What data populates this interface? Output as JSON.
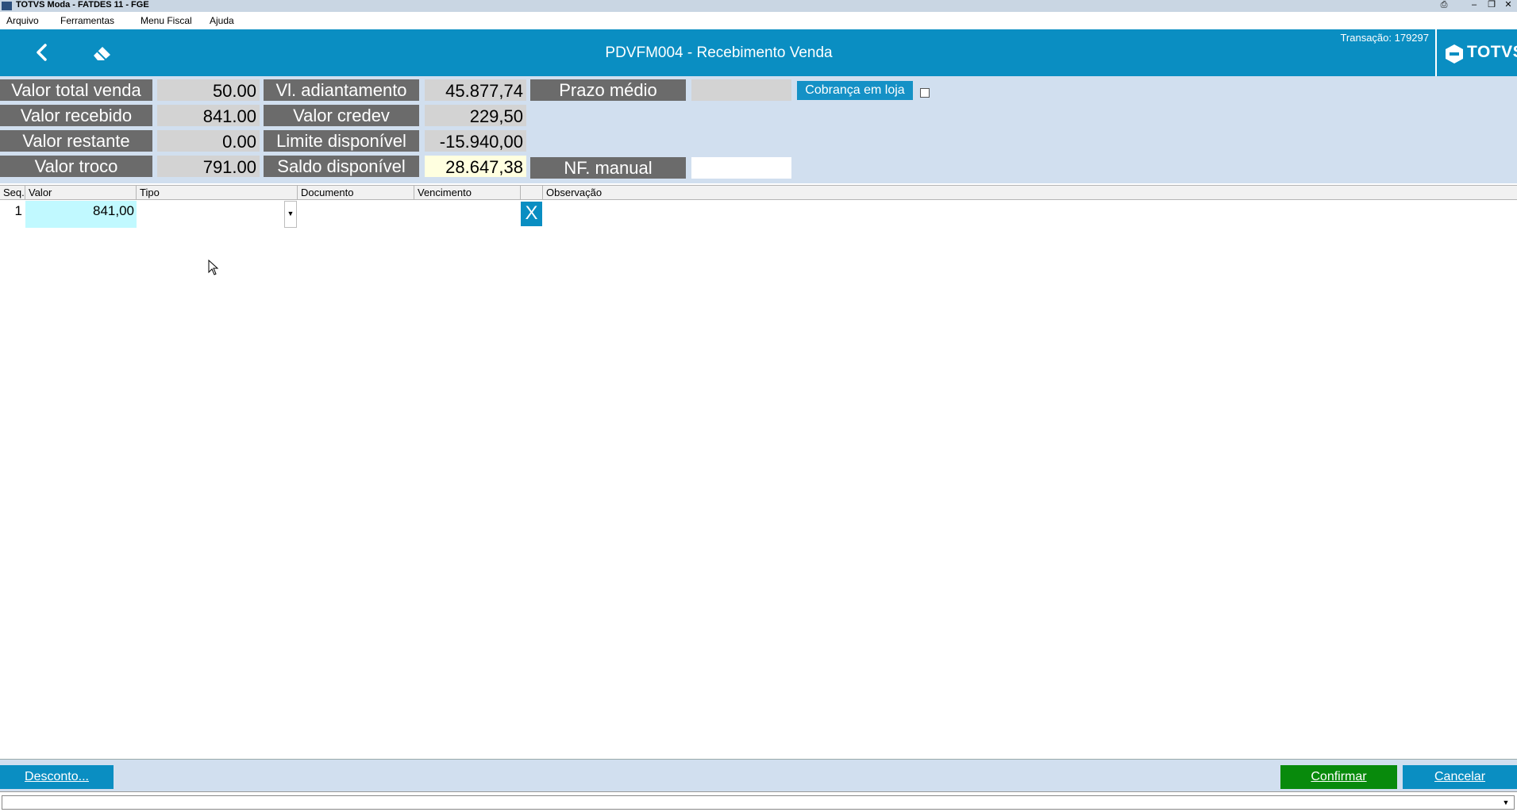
{
  "window": {
    "title": "TOTVS Moda - FATDES 11 - FGE"
  },
  "menu": {
    "items": [
      "Arquivo",
      "Ferramentas",
      "Menu Fiscal",
      "Ajuda"
    ]
  },
  "header": {
    "title": "PDVFM004 - Recebimento Venda",
    "transaction": "Transação: 179297",
    "logo_text": "TOTVS"
  },
  "summary": {
    "valor_total_venda": {
      "label": "Valor total venda",
      "value": "50.00"
    },
    "valor_recebido": {
      "label": "Valor recebido",
      "value": "841.00"
    },
    "valor_restante": {
      "label": "Valor restante",
      "value": "0.00"
    },
    "valor_troco": {
      "label": "Valor troco",
      "value": "791.00"
    },
    "vl_adiantamento": {
      "label": "Vl. adiantamento",
      "value": "45.877,74"
    },
    "valor_credev": {
      "label": "Valor credev",
      "value": "229,50"
    },
    "limite_disponivel": {
      "label": "Limite disponível",
      "value": "-15.940,00"
    },
    "saldo_disponivel": {
      "label": "Saldo disponível",
      "value": "28.647,38"
    },
    "prazo_medio": {
      "label": "Prazo médio",
      "value": ""
    },
    "nf_manual": {
      "label": "NF. manual",
      "value": ""
    },
    "cobranca_button": "Cobrança em loja"
  },
  "grid": {
    "columns": [
      "Seq.",
      "Valor",
      "Tipo",
      "Documento",
      "Vencimento",
      "",
      "Observação"
    ],
    "rows": [
      {
        "seq": "1",
        "valor": "841,00",
        "tipo": "",
        "documento": "",
        "vencimento": "",
        "observacao": ""
      }
    ],
    "delete_label": "X"
  },
  "footer": {
    "desconto": "Desconto...",
    "confirmar": "Confirmar",
    "cancelar": "Cancelar"
  },
  "colors": {
    "header": "#0a8ec2",
    "panel": "#d1dfef",
    "label_bg": "#6b6b6b",
    "confirm": "#088a0c"
  }
}
